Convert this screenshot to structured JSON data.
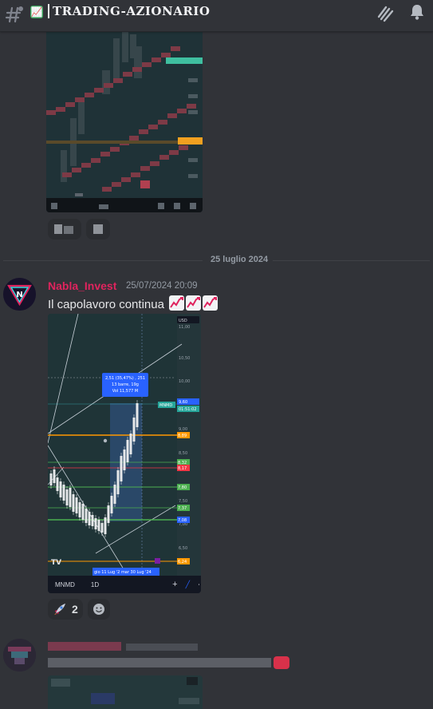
{
  "header": {
    "channel_emoji": "📈",
    "channel_name": "TRADING-AZIONARIO",
    "icons": [
      "hash-icon",
      "threads-icon",
      "bell-icon"
    ]
  },
  "divider": {
    "date_label": "25 luglio 2024"
  },
  "message": {
    "author": "Nabla_Invest",
    "author_color": "#e0245e",
    "timestamp": "25/07/2024 20:09",
    "text": "Il capolavoro continua",
    "text_emojis": [
      "chart-increasing-emoji",
      "chart-increasing-emoji",
      "chart-increasing-emoji"
    ]
  },
  "chart": {
    "currency": "USD",
    "annotation": {
      "line1": "2,51 (35,47%) , 251",
      "line2": "13 barre, 19g",
      "line3": "Vol 11,577 M"
    },
    "last_price_tag": "9,60",
    "symbol_tag": "MNMD",
    "countdown_tag": "01:51:02",
    "date_range_label": "gio 11 Lug '2   mar 30 Lug '24",
    "footer": {
      "symbol": "MNMD",
      "interval": "1D"
    },
    "price_tags": [
      {
        "label": "8,89",
        "color": "#ff9800"
      },
      {
        "label": "8,32",
        "color": "#4caf50"
      },
      {
        "label": "8,17",
        "color": "#f23645"
      },
      {
        "label": "7,80",
        "color": "#4caf50"
      },
      {
        "label": "7,37",
        "color": "#4caf50"
      },
      {
        "label": "7,08",
        "color": "#2962ff"
      },
      {
        "label": "6,24",
        "color": "#ff9800"
      }
    ],
    "axis_labels": [
      "11,00",
      "10,50",
      "10,00",
      "9,00",
      "8,50",
      "7,50",
      "7,00",
      "6,50"
    ],
    "chart_data": {
      "type": "candlestick",
      "x": [
        "11 Lug '24",
        "30 Lug '24"
      ],
      "y_label_range": [
        6.5,
        11.0
      ],
      "measure": {
        "change": "2,51",
        "change_pct": "35,47%",
        "bars": 13,
        "days": 19,
        "volume": "11,577 M"
      },
      "last": 9.6
    }
  },
  "reactions": [
    {
      "emoji": "rocket",
      "count": "2"
    },
    {
      "emoji": "add-reaction",
      "count": ""
    }
  ]
}
